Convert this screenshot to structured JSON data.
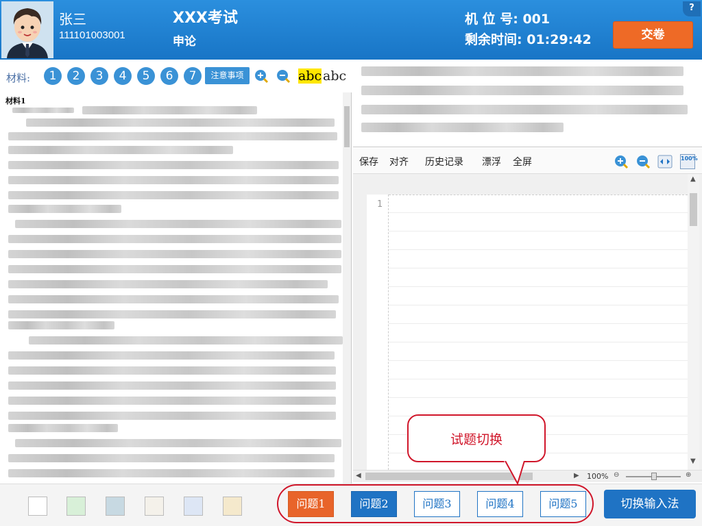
{
  "header": {
    "candidate_name": "张三",
    "candidate_id": "111101003001",
    "exam_title": "XXX考试",
    "exam_subject": "申论",
    "seat_label": "机 位 号:",
    "seat_number": "001",
    "time_label": "剩余时间:",
    "time_remaining": "01:29:42",
    "submit_label": "交卷",
    "help_label": "?"
  },
  "materials": {
    "label": "材料:",
    "numbers": [
      "1",
      "2",
      "3",
      "4",
      "5",
      "6",
      "7"
    ],
    "notice_label": "注意事项",
    "highlight_sample": "abc",
    "plain_sample": "abc",
    "heading": "材料1"
  },
  "editor": {
    "buttons": [
      "保存",
      "对齐",
      "历史记录",
      "漂浮",
      "全屏"
    ],
    "line_number": "1",
    "zoom_label": "100%",
    "zoom_reset_label": "100%"
  },
  "bottom": {
    "question_tabs": [
      "问题1",
      "问题2",
      "问题3",
      "问题4",
      "问题5"
    ],
    "ime_label": "切换输入法",
    "swatch_colors": [
      "#ffffff",
      "#d8f0d8",
      "#c7d9e2",
      "#f4f1ea",
      "#dde6f5",
      "#f5e9cc"
    ]
  },
  "callout": {
    "text": "试题切换"
  },
  "colors": {
    "header_blue": "#1f7fd0",
    "accent_orange": "#ee6a26",
    "tab_blue": "#1f73c4",
    "callout_red": "#d0162a"
  }
}
